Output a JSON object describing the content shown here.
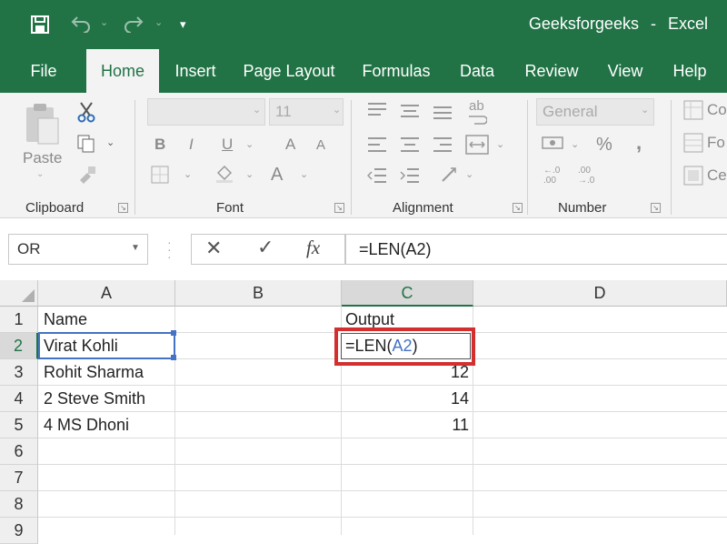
{
  "window": {
    "title": "Geeksforgeeks",
    "app": "Excel",
    "title_sep": "-"
  },
  "qat": {
    "save_icon": "save-icon",
    "undo_icon": "undo-icon",
    "redo_icon": "redo-icon",
    "customize_icon": "customize-qat-icon"
  },
  "ribbon_tabs": [
    "File",
    "Home",
    "Insert",
    "Page Layout",
    "Formulas",
    "Data",
    "Review",
    "View",
    "Help"
  ],
  "active_tab": "Home",
  "clipboard": {
    "label": "Clipboard",
    "paste": "Paste"
  },
  "font": {
    "label": "Font",
    "size": "11",
    "bold": "B",
    "italic": "I",
    "underline": "U",
    "grow": "A",
    "shrink": "A",
    "font_color": "A"
  },
  "alignment": {
    "label": "Alignment",
    "wrap": "ab"
  },
  "number": {
    "label": "Number",
    "format": "General",
    "percent": "%",
    "comma": ","
  },
  "styles": {
    "conditional": "Co",
    "format_table": "Fo",
    "cell_styles": "Ce"
  },
  "formula_bar": {
    "name_box": "OR",
    "cancel": "✕",
    "enter": "✓",
    "fx": "fx",
    "formula": "=LEN(A2)"
  },
  "columns": [
    "A",
    "B",
    "C",
    "D"
  ],
  "rows": [
    "1",
    "2",
    "3",
    "4",
    "5",
    "6",
    "7",
    "8",
    "9"
  ],
  "cells": {
    "A1": "Name",
    "A2": "Virat Kohli",
    "A3": "Rohit Sharma",
    "A4": "2 Steve Smith",
    "A5": "4  MS Dhoni",
    "C1": "Output",
    "C2_prefix": "=LEN(",
    "C2_ref": "A2",
    "C2_suffix": ")",
    "C3": "12",
    "C4": "14",
    "C5": "11"
  },
  "colors": {
    "excel_green": "#217346",
    "highlight_red": "#d32f2f",
    "ref_blue": "#4472c4"
  }
}
